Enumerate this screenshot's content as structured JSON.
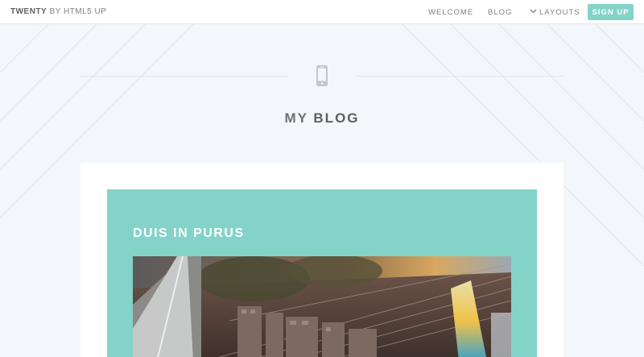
{
  "header": {
    "brand_bold": "TWENTY",
    "brand_rest": "BY HTML5 UP",
    "nav": {
      "welcome": "WELCOME",
      "blog": "BLOG",
      "layouts": "LAYOUTS",
      "signup": "SIGN UP"
    }
  },
  "page": {
    "title_part1": "MY",
    "title_part2": "BLOG",
    "icon": "mobile-phone-icon"
  },
  "post": {
    "title": "DUIS IN PURUS"
  },
  "colors": {
    "accent": "#83d3c9",
    "background": "#f3f6fa",
    "text": "#7c8081"
  }
}
